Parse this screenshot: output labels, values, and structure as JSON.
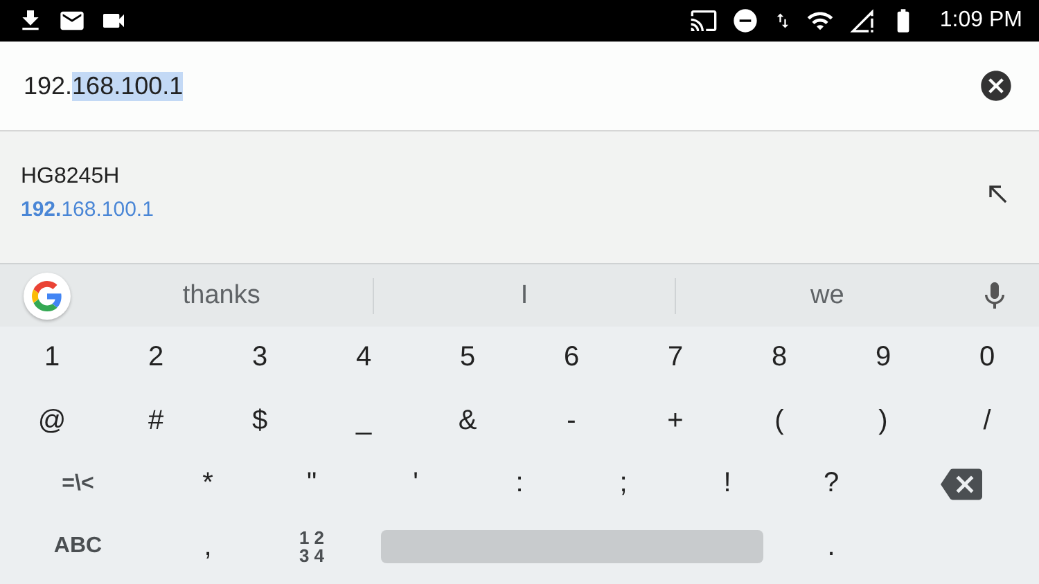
{
  "status_bar": {
    "time": "1:09 PM"
  },
  "url_field": {
    "parts": [
      {
        "text": "192.",
        "selected": false
      },
      {
        "text": "168.100.1",
        "selected": true
      }
    ]
  },
  "suggestions": [
    {
      "title": "HG8245H",
      "url": "**192.**168.100.1"
    }
  ],
  "keyboard": {
    "suggestions": [
      "thanks",
      "I",
      "we"
    ],
    "rows": [
      [
        {
          "kind": "char",
          "label": "1"
        },
        {
          "kind": "char",
          "label": "2"
        },
        {
          "kind": "char",
          "label": "3"
        },
        {
          "kind": "char",
          "label": "4"
        },
        {
          "kind": "char",
          "label": "5"
        },
        {
          "kind": "char",
          "label": "6"
        },
        {
          "kind": "char",
          "label": "7"
        },
        {
          "kind": "char",
          "label": "8"
        },
        {
          "kind": "char",
          "label": "9"
        },
        {
          "kind": "char",
          "label": "0"
        }
      ],
      [
        {
          "kind": "char",
          "label": "@"
        },
        {
          "kind": "char",
          "label": "#"
        },
        {
          "kind": "char",
          "label": "$"
        },
        {
          "kind": "char",
          "label": "_"
        },
        {
          "kind": "char",
          "label": "&"
        },
        {
          "kind": "char",
          "label": "-"
        },
        {
          "kind": "char",
          "label": "+"
        },
        {
          "kind": "char",
          "label": "("
        },
        {
          "kind": "char",
          "label": ")"
        },
        {
          "kind": "char",
          "label": "/"
        }
      ],
      [
        {
          "kind": "mode",
          "label": "=\\<"
        },
        {
          "kind": "char",
          "label": "*"
        },
        {
          "kind": "char",
          "label": "\""
        },
        {
          "kind": "char",
          "label": "'"
        },
        {
          "kind": "char",
          "label": ":"
        },
        {
          "kind": "char",
          "label": ";"
        },
        {
          "kind": "char",
          "label": "!"
        },
        {
          "kind": "char",
          "label": "?"
        },
        {
          "kind": "backspace"
        }
      ],
      [
        {
          "kind": "mode",
          "label": "ABC"
        },
        {
          "kind": "char",
          "label": ","
        },
        {
          "kind": "stacked",
          "lines": [
            "1 2",
            "3 4"
          ]
        },
        {
          "kind": "space"
        },
        {
          "kind": "char",
          "label": "."
        }
      ]
    ]
  }
}
